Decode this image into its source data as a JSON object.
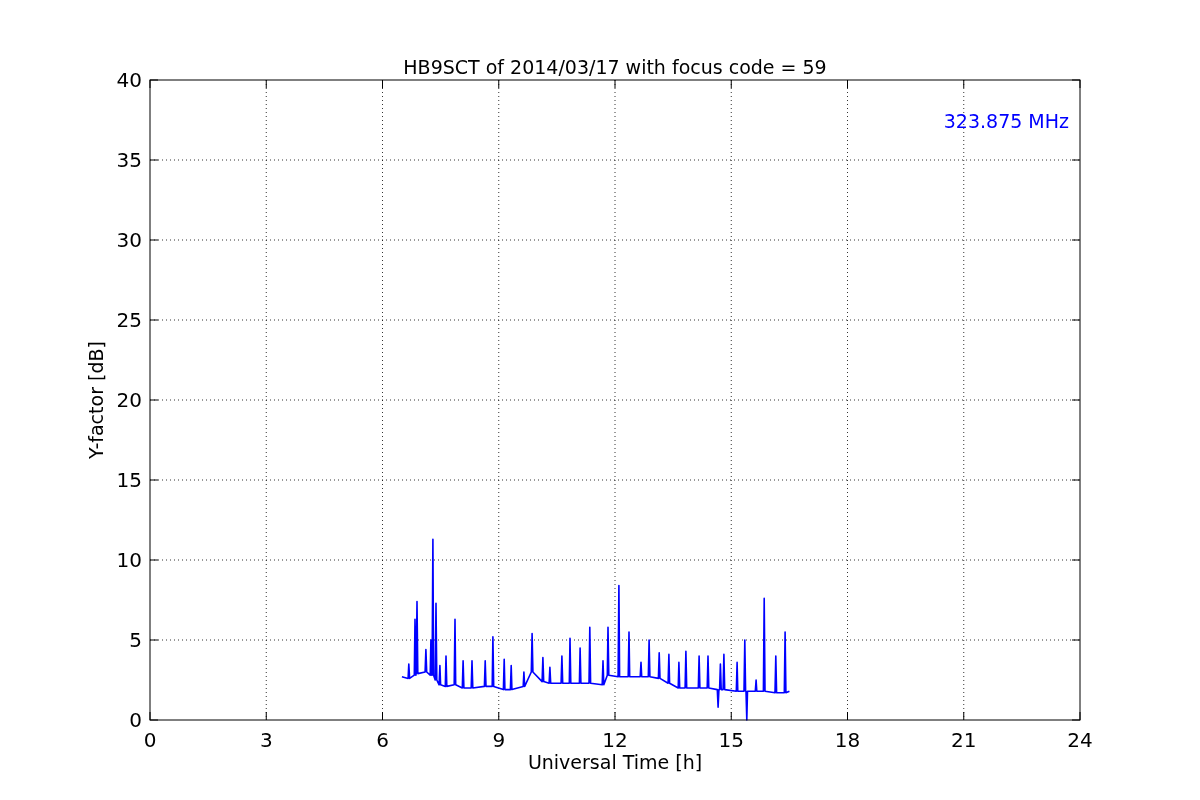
{
  "chart_data": {
    "type": "line",
    "title": "HB9SCT of 2014/03/17 with focus code = 59",
    "xlabel": "Universal Time [h]",
    "ylabel": "Y-factor [dB]",
    "grid": true,
    "xlim": [
      0,
      24
    ],
    "ylim": [
      0,
      40
    ],
    "xticks": [
      0,
      3,
      6,
      9,
      12,
      15,
      18,
      21,
      24
    ],
    "yticks": [
      0,
      5,
      10,
      15,
      20,
      25,
      30,
      35,
      40
    ],
    "x": [
      6.5,
      6.66,
      6.68,
      6.7,
      6.82,
      6.84,
      6.86,
      6.87,
      6.89,
      6.91,
      7.1,
      7.12,
      7.14,
      7.23,
      7.25,
      7.27,
      7.28,
      7.3,
      7.32,
      7.36,
      7.38,
      7.4,
      7.46,
      7.48,
      7.5,
      7.62,
      7.64,
      7.66,
      7.85,
      7.87,
      7.89,
      8.06,
      8.08,
      8.1,
      8.29,
      8.31,
      8.33,
      8.63,
      8.65,
      8.67,
      8.83,
      8.85,
      8.87,
      9.12,
      9.14,
      9.16,
      9.3,
      9.32,
      9.34,
      9.63,
      9.65,
      9.67,
      9.84,
      9.86,
      9.88,
      10.12,
      10.14,
      10.16,
      10.3,
      10.32,
      10.34,
      10.61,
      10.63,
      10.65,
      10.82,
      10.84,
      10.86,
      11.08,
      11.1,
      11.12,
      11.33,
      11.35,
      11.37,
      11.67,
      11.69,
      11.71,
      11.8,
      11.82,
      11.84,
      12.08,
      12.1,
      12.12,
      12.34,
      12.36,
      12.38,
      12.65,
      12.67,
      12.69,
      12.86,
      12.88,
      12.9,
      13.12,
      13.14,
      13.16,
      13.37,
      13.39,
      13.41,
      13.63,
      13.65,
      13.67,
      13.81,
      13.83,
      13.85,
      14.15,
      14.17,
      14.19,
      14.38,
      14.4,
      14.42,
      14.64,
      14.66,
      14.68,
      14.7,
      14.72,
      14.74,
      14.79,
      14.81,
      14.83,
      15.13,
      15.15,
      15.17,
      15.33,
      15.35,
      15.37,
      15.38,
      15.4,
      15.42,
      15.62,
      15.64,
      15.66,
      15.83,
      15.85,
      15.87,
      16.13,
      16.15,
      16.17,
      16.37,
      16.39,
      16.41,
      16.5
    ],
    "series": [
      {
        "name": "323.875 MHz",
        "color": "#0000ff",
        "values": [
          2.7,
          2.6,
          3.5,
          2.6,
          2.8,
          6.3,
          2.8,
          2.9,
          7.4,
          2.9,
          3.0,
          4.4,
          3.0,
          2.8,
          5.0,
          2.8,
          2.8,
          11.3,
          2.8,
          2.5,
          7.3,
          2.5,
          2.2,
          3.4,
          2.2,
          2.1,
          4.0,
          2.1,
          2.2,
          6.3,
          2.2,
          2.0,
          3.7,
          2.0,
          2.0,
          3.7,
          2.0,
          2.1,
          3.7,
          2.1,
          2.1,
          5.2,
          2.1,
          1.9,
          3.8,
          1.9,
          1.9,
          3.4,
          1.9,
          2.1,
          3.0,
          2.1,
          3.0,
          5.4,
          3.0,
          2.4,
          3.9,
          2.4,
          2.3,
          3.3,
          2.3,
          2.3,
          4.0,
          2.3,
          2.3,
          5.1,
          2.3,
          2.3,
          4.5,
          2.3,
          2.3,
          5.8,
          2.3,
          2.2,
          3.7,
          2.2,
          2.8,
          5.8,
          2.8,
          2.7,
          8.4,
          2.7,
          2.7,
          5.5,
          2.7,
          2.7,
          3.6,
          2.7,
          2.7,
          5.0,
          2.7,
          2.6,
          4.2,
          2.6,
          2.3,
          4.1,
          2.3,
          2.0,
          3.6,
          2.0,
          2.0,
          4.3,
          2.0,
          2.0,
          4.0,
          2.0,
          2.0,
          4.0,
          2.0,
          1.9,
          0.8,
          1.9,
          1.9,
          3.5,
          1.9,
          1.9,
          4.1,
          1.9,
          1.8,
          3.6,
          1.8,
          1.8,
          5.0,
          1.8,
          1.8,
          0.0,
          1.8,
          1.8,
          2.5,
          1.8,
          1.8,
          7.6,
          1.8,
          1.7,
          4.0,
          1.7,
          1.7,
          5.5,
          1.7,
          1.8
        ]
      }
    ]
  }
}
